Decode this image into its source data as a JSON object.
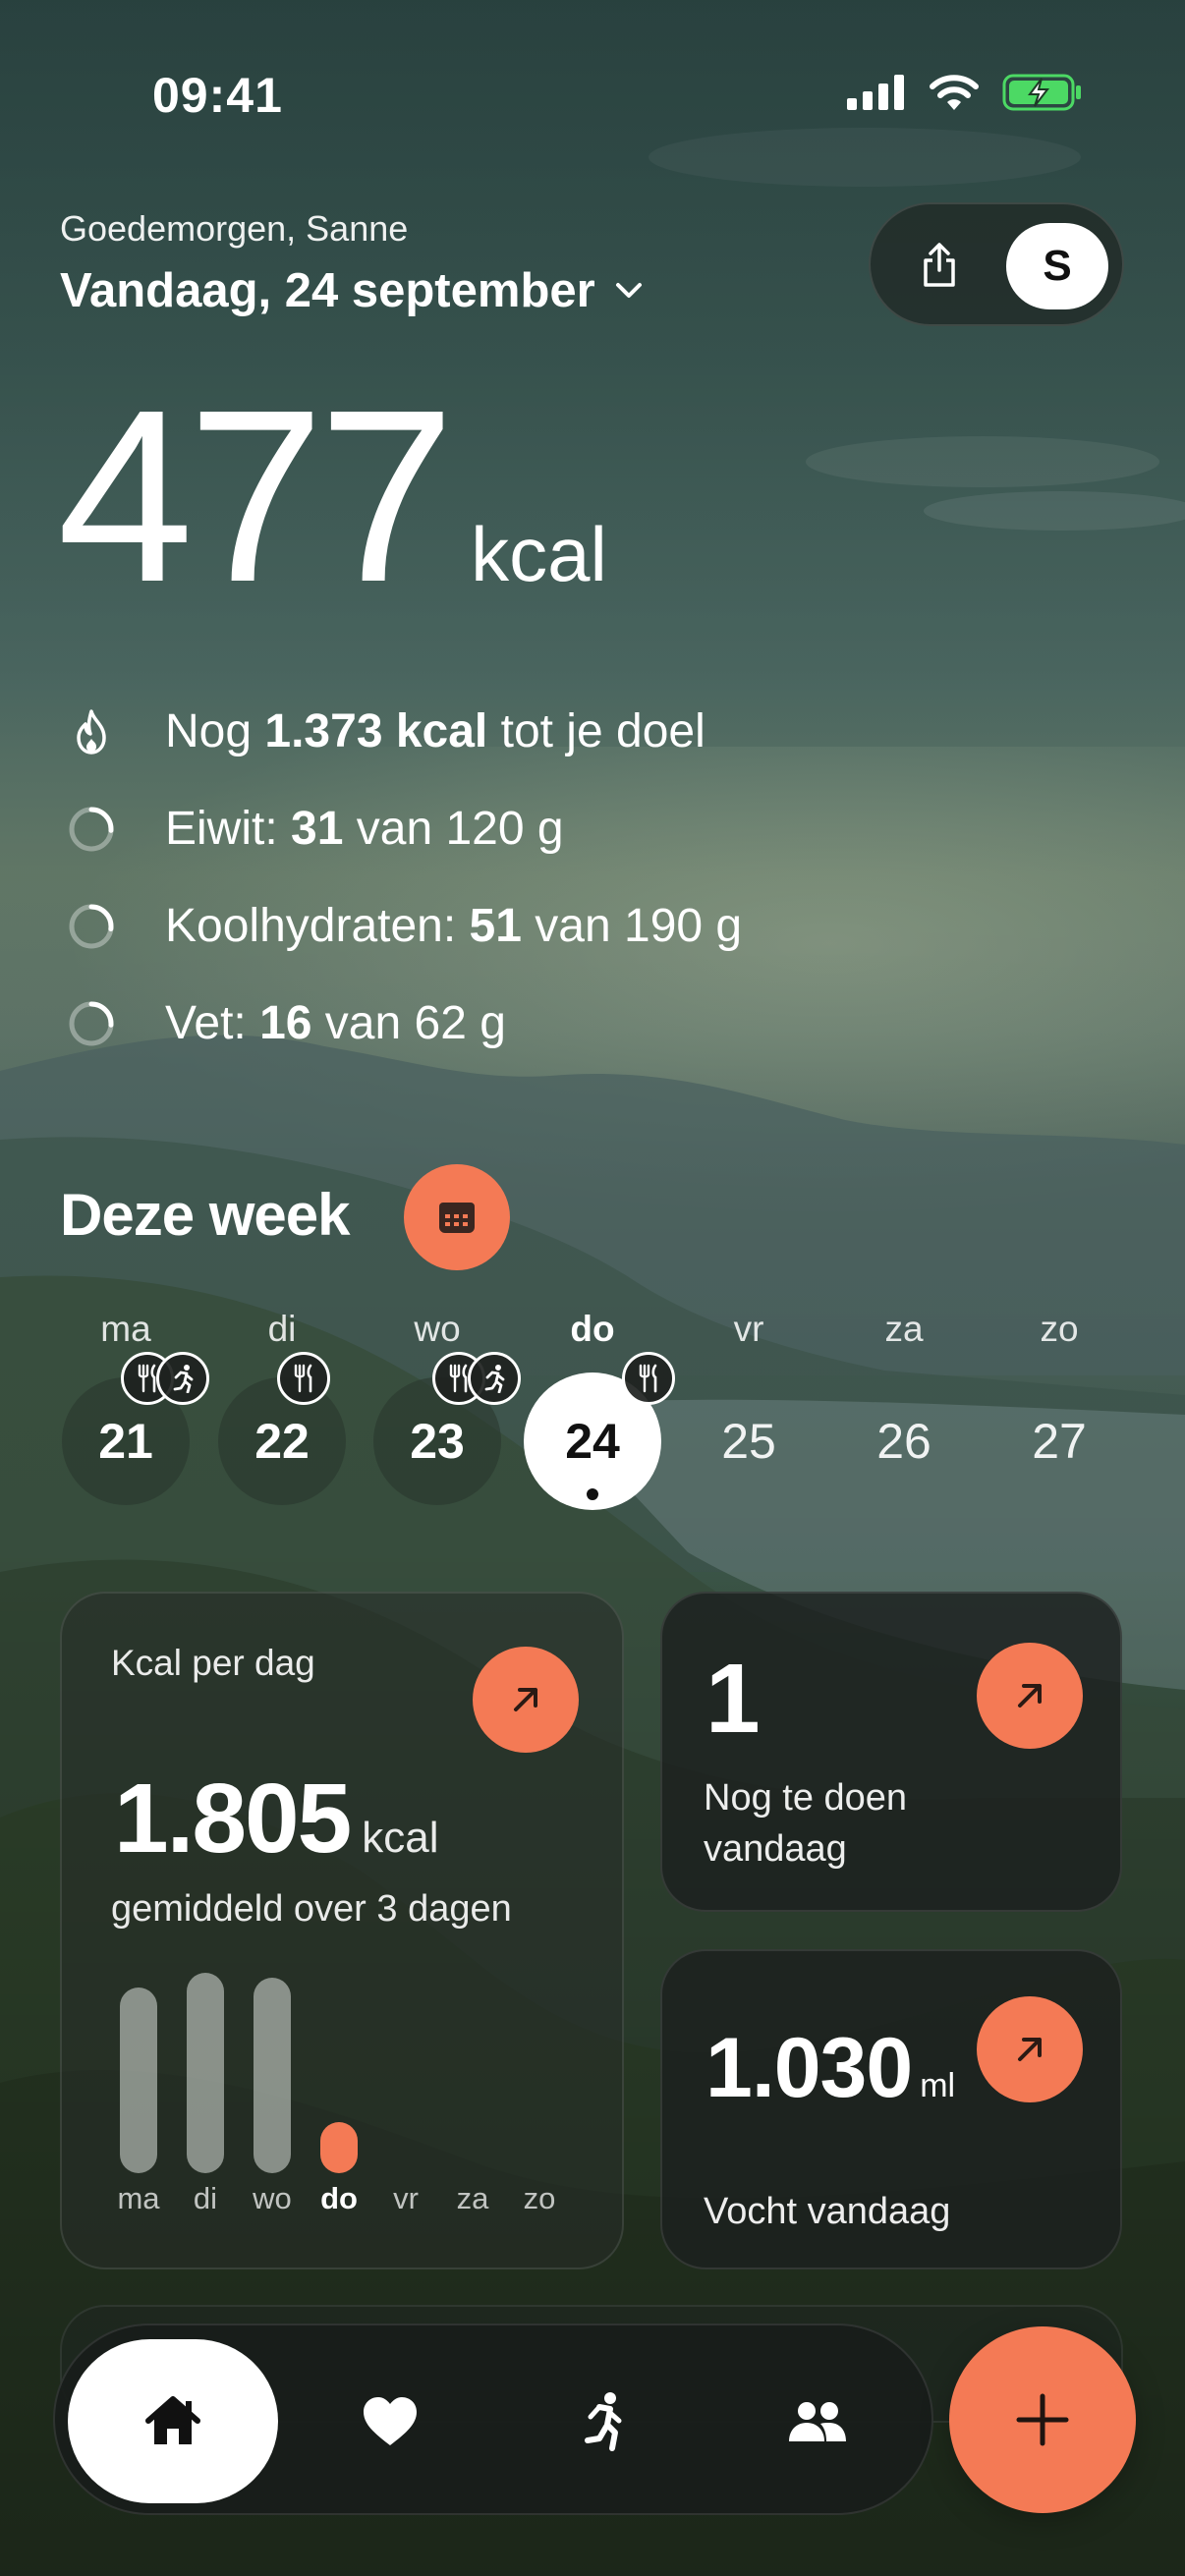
{
  "status_bar": {
    "time": "09:41",
    "icons": [
      "cellular-signal-icon",
      "wifi-icon",
      "battery-charging-icon"
    ]
  },
  "header": {
    "greeting": "Goedemorgen, Sanne",
    "date": "Vandaag, 24 september",
    "avatar_initial": "S"
  },
  "summary": {
    "kcal_value": "477",
    "kcal_unit": "kcal",
    "goal_prefix": "Nog ",
    "goal_value": "1.373 kcal",
    "goal_suffix": " tot je doel",
    "protein_label": "Eiwit: ",
    "protein_value": "31",
    "protein_suffix": " van 120 g",
    "protein_progress": 0.26,
    "carbs_label": "Koolhydraten: ",
    "carbs_value": "51",
    "carbs_suffix": " van 190 g",
    "carbs_progress": 0.27,
    "fat_label": "Vet: ",
    "fat_value": "16",
    "fat_suffix": " van 62 g",
    "fat_progress": 0.26
  },
  "week": {
    "title": "Deze week",
    "days": [
      {
        "label": "ma",
        "date": "21",
        "logged": true,
        "meal": true,
        "activity": true
      },
      {
        "label": "di",
        "date": "22",
        "logged": true,
        "meal": true,
        "activity": false
      },
      {
        "label": "wo",
        "date": "23",
        "logged": true,
        "meal": true,
        "activity": true
      },
      {
        "label": "do",
        "date": "24",
        "today": true,
        "meal": true,
        "activity": false
      },
      {
        "label": "vr",
        "date": "25"
      },
      {
        "label": "za",
        "date": "26"
      },
      {
        "label": "zo",
        "date": "27"
      }
    ]
  },
  "cards": {
    "kcal_per_day": {
      "title": "Kcal per dag",
      "value": "1.805",
      "unit": "kcal",
      "subtitle": "gemiddeld over 3 dagen",
      "bars": [
        {
          "label": "ma",
          "fraction": 0.9
        },
        {
          "label": "di",
          "fraction": 0.97
        },
        {
          "label": "wo",
          "fraction": 0.95
        },
        {
          "label": "do",
          "fraction": 0.24,
          "today": true
        },
        {
          "label": "vr",
          "fraction": 0
        },
        {
          "label": "za",
          "fraction": 0
        },
        {
          "label": "zo",
          "fraction": 0
        }
      ]
    },
    "todo": {
      "value": "1",
      "label": "Nog te doen vandaag"
    },
    "fluid": {
      "value": "1.030",
      "unit": "ml",
      "label": "Vocht vandaag"
    }
  },
  "tabbar": {
    "tabs": [
      {
        "icon": "home-icon",
        "active": true
      },
      {
        "icon": "heart-icon"
      },
      {
        "icon": "running-icon"
      },
      {
        "icon": "people-icon"
      }
    ],
    "fab_icon": "plus-icon"
  },
  "colors": {
    "accent": "#f47a55",
    "battery": "#4cd964"
  }
}
